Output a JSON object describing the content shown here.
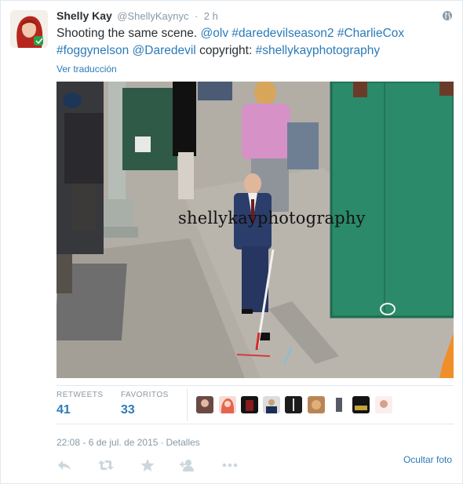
{
  "user": {
    "fullname": "Shelly Kay",
    "username": "@ShellyKaynyc",
    "separator": "·",
    "time": "2 h"
  },
  "icons": {
    "avatar": "profile-photo-red-hair",
    "globe": "globe-icon",
    "reply": "reply-icon",
    "retweet": "retweet-icon",
    "favorite": "star-icon",
    "follow": "follow-icon",
    "more": "more-dots-icon"
  },
  "tweet": {
    "text_plain_1": "Shooting the same scene. ",
    "mention_1": "@olv",
    "hashtag_1": "#daredevilseason2",
    "hashtag_2": "#CharlieCox",
    "hashtag_3": "#foggynelson",
    "mention_2": "@Daredevil",
    "text_plain_2": "copyright: ",
    "hashtag_4": "#shellykayphotography"
  },
  "translate_label": "Ver traducción",
  "media": {
    "watermark": "shellykayphotography"
  },
  "stats": {
    "retweets_label": "RETWEETS",
    "retweets_value": "41",
    "favorites_label": "FAVORITOS",
    "favorites_value": "33"
  },
  "favorited_by_count": 10,
  "footer": {
    "datetime": "22:08 - 6 de jul. de 2015",
    "separator": "·",
    "details_label": "Detalles",
    "hide_photo_label": "Ocultar foto"
  },
  "colors": {
    "link": "#2b7bb9",
    "muted": "#8899a6",
    "text": "#292f33",
    "action_icon": "#ccd6dd"
  }
}
